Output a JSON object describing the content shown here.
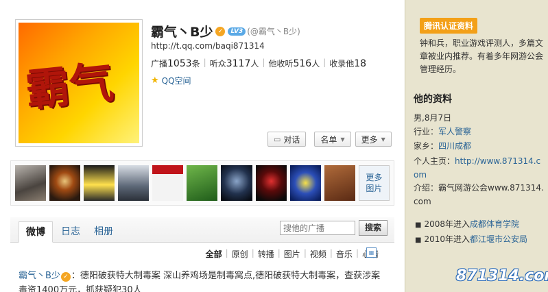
{
  "profile": {
    "name": "霸气丶B少",
    "level": "LV3",
    "handle": "(@霸气丶B少)",
    "url": "http://t.qq.com/baqi871314",
    "avatar_text": "霸气",
    "stats": {
      "broadcast_label": "广播",
      "broadcast_value": "1053",
      "broadcast_unit": "条",
      "listeners_label": "听众",
      "listeners_value": "3117",
      "listeners_unit": "人",
      "he_listens_label": "他收听",
      "he_listens_value": "516",
      "he_listens_unit": "人",
      "collected_label": "收录他",
      "collected_value": "18"
    },
    "qzone_label": "QQ空间"
  },
  "actions": {
    "chat": "对话",
    "list": "名单",
    "more": "更多"
  },
  "photos": {
    "more_label_1": "更多",
    "more_label_2": "图片"
  },
  "tabs": {
    "weibo": "微博",
    "diary": "日志",
    "album": "相册"
  },
  "search": {
    "placeholder": "搜他的广播",
    "button": "搜索"
  },
  "filters": [
    "全部",
    "原创",
    "转播",
    "图片",
    "视频",
    "音乐",
    "心情"
  ],
  "post": {
    "author": "霸气丶B少",
    "text": "：德阳破获特大制毒案 深山养鸡场是制毒窝点,德阳破获特大制毒案，查获涉案毒资1400万元，抓获疑犯30人"
  },
  "sidebar": {
    "verify_tag": "腾讯认证资料",
    "verify_text": "钟和兵，职业游戏评测人，多篇文章被业内推荐。有着多年网游公会管理经历。",
    "profile_heading": "他的资料",
    "gender_birthday": "男,8月7日",
    "industry_label": "行业：",
    "industry_value": "军人警察",
    "hometown_label": "家乡：",
    "hometown_value": "四川成都",
    "homepage_label": "个人主页：",
    "homepage_value": "http://www.871314.com",
    "intro_label": "介绍：",
    "intro_value": "霸气网游公会www.871314.com",
    "history_1_prefix": "2008年进入",
    "history_1_link": "成都体育学院",
    "history_2_prefix": "2010年进入",
    "history_2_link": "都江堰市公安局"
  },
  "watermark": "871314.com"
}
